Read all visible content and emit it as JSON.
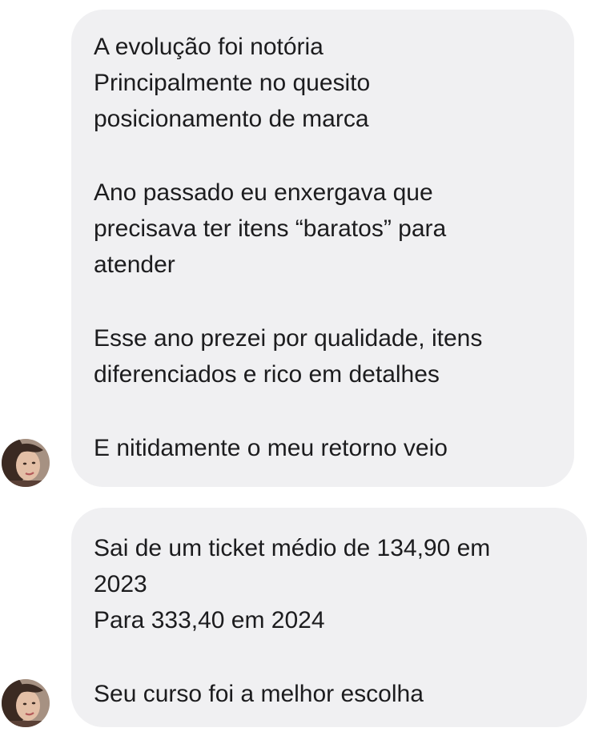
{
  "messages": [
    {
      "paragraphs": [
        [
          "A evolução foi notória",
          "Principalmente no quesito",
          "posicionamento de marca"
        ],
        [
          "Ano passado eu enxergava que",
          "precisava ter itens “baratos” para",
          "atender"
        ],
        [
          "Esse ano prezei por qualidade, itens",
          "diferenciados e rico em detalhes"
        ],
        [
          "E nitidamente o meu retorno veio"
        ]
      ]
    },
    {
      "paragraphs": [
        [
          "Sai de um ticket médio de 134,90 em",
          "2023",
          "Para 333,40 em 2024"
        ],
        [
          "Seu curso foi a melhor escolha"
        ]
      ]
    }
  ],
  "colors": {
    "bubble_background": "#f0f0f2",
    "text": "#1c1c1e"
  },
  "avatar": {
    "icon": "user-avatar-photo"
  }
}
